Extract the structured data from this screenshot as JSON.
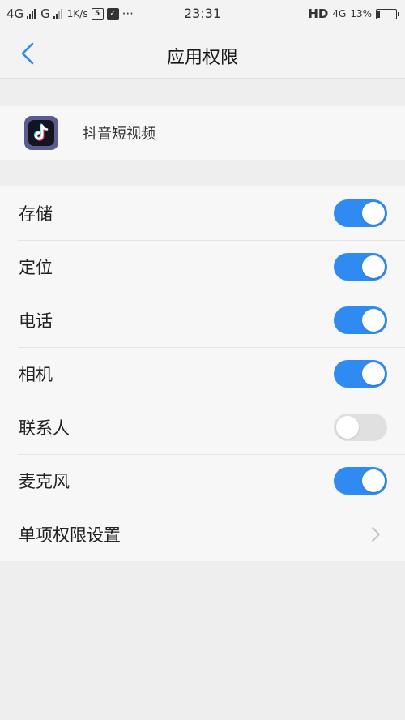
{
  "status_bar": {
    "network1": "4G",
    "network2": "G",
    "speed": "1K/s",
    "time": "23:31",
    "hd": "HD",
    "network3": "4G",
    "battery_percent": "13%",
    "battery_level": 0.13
  },
  "header": {
    "title": "应用权限",
    "back_icon": "chevron-left-icon"
  },
  "app": {
    "name": "抖音短视频",
    "icon": "douyin-app-icon"
  },
  "permissions": [
    {
      "label": "存储",
      "enabled": true
    },
    {
      "label": "定位",
      "enabled": true
    },
    {
      "label": "电话",
      "enabled": true
    },
    {
      "label": "相机",
      "enabled": true
    },
    {
      "label": "联系人",
      "enabled": false
    },
    {
      "label": "麦克风",
      "enabled": true
    }
  ],
  "detail_settings": {
    "label": "单项权限设置",
    "icon": "chevron-right-icon"
  },
  "colors": {
    "accent": "#2f8af2",
    "toggle_off": "#e0e0e0",
    "page_bg": "#eeeeee",
    "card_bg": "#f7f7f7"
  }
}
